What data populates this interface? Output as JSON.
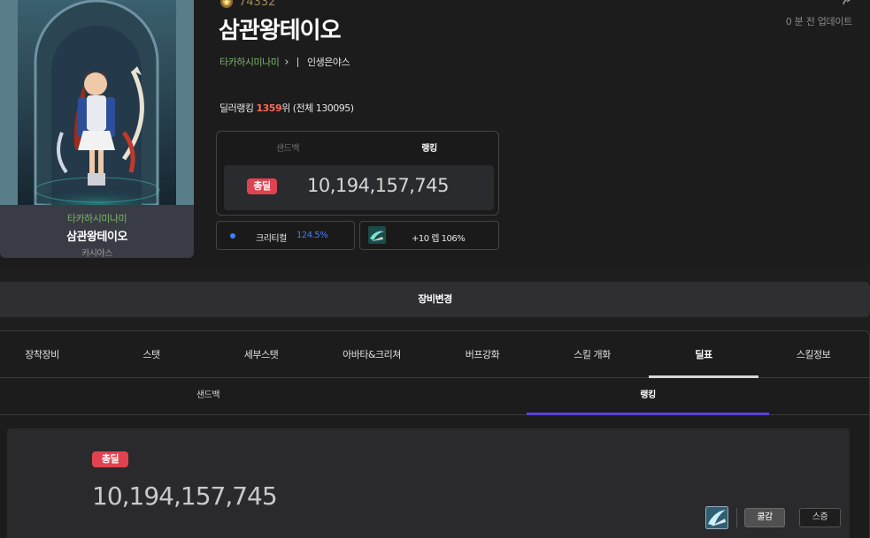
{
  "profile": {
    "fame": "74332",
    "update_text": "0 분 전 업데이트",
    "character_name": "삼관왕테이오",
    "adventure_name": "타카하시미나미",
    "guild_name": "인생은야스",
    "rank_prefix": "딜러랭킹 ",
    "rank_value": "1359",
    "rank_suffix": "위 (전체 130095)"
  },
  "card": {
    "adventure_name": "타카하시미나미",
    "character_name": "삼관왕테이오",
    "server": "카시야스"
  },
  "damage_box": {
    "tab_sandbag": "샌드백",
    "tab_ranking": "랭킹",
    "badge": "총딜",
    "value": "10,194,157,745"
  },
  "stats": {
    "crit_label": "크리티컬",
    "crit_value": "124.5%",
    "buff_text": "+10 렙 106%"
  },
  "equip_change": "장비변경",
  "main_tabs": [
    "장착장비",
    "스탯",
    "세부스탯",
    "아바타&크리쳐",
    "버프강화",
    "스킬 개화",
    "딜표",
    "스킬정보"
  ],
  "sub_tabs": [
    "샌드백",
    "랭킹"
  ],
  "result": {
    "badge": "총딜",
    "value": "10,194,157,745",
    "btn_cool": "쿨감",
    "btn_stack": "스증"
  },
  "colors": {
    "accent_purple": "#5a43d6",
    "badge_red": "#e0434f",
    "crit_blue": "#3d7eff",
    "adventure_green": "#7bb36a"
  }
}
